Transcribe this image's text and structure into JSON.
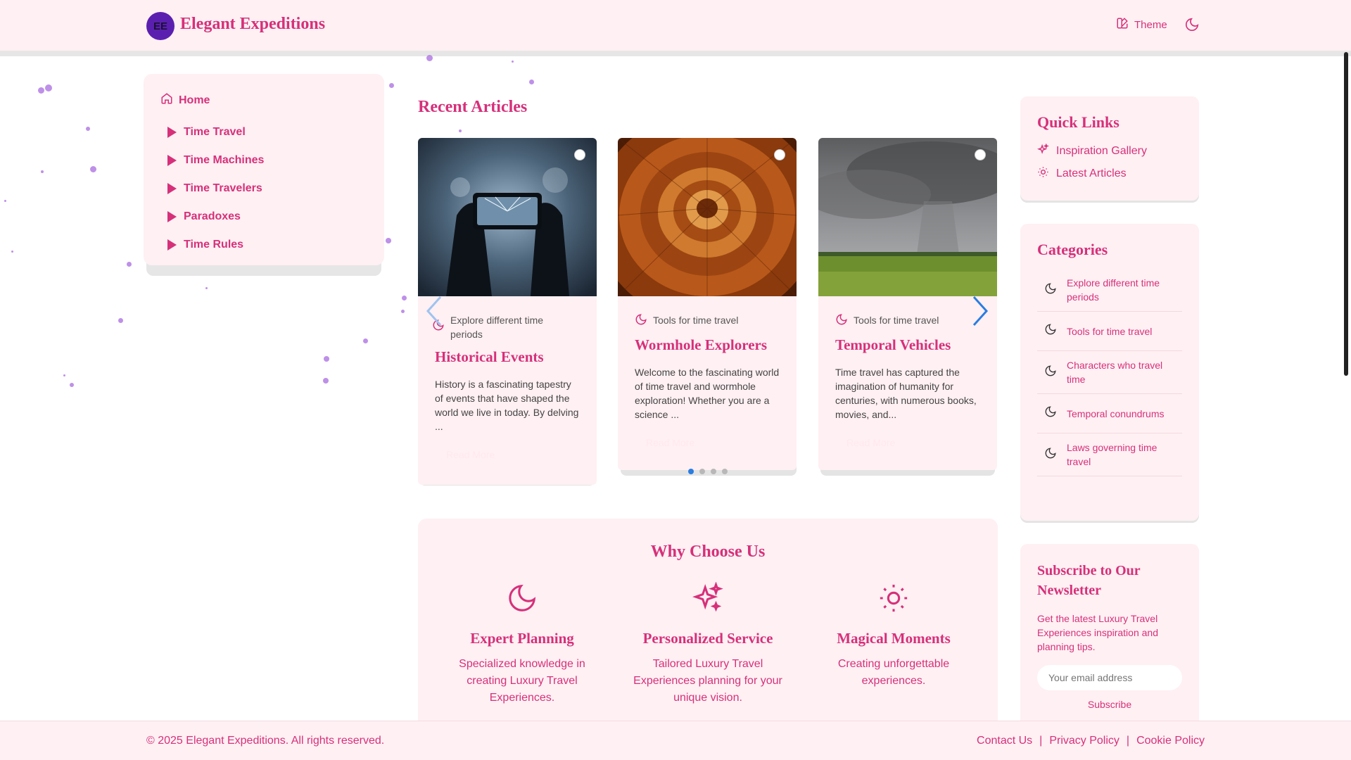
{
  "header": {
    "logo_initials": "EE",
    "title": "Elegant Expeditions",
    "theme_label": "Theme"
  },
  "sidebar": {
    "home": "Home",
    "items": [
      {
        "label": "Time Travel"
      },
      {
        "label": "Time Machines"
      },
      {
        "label": "Time Travelers"
      },
      {
        "label": "Paradoxes"
      },
      {
        "label": "Time Rules"
      }
    ]
  },
  "main": {
    "recent_title": "Recent Articles",
    "cards": [
      {
        "category": "Explore different time periods",
        "title": "Historical Events",
        "text": "History is a fascinating tapestry of events that have shaped the world we live in today. By delving ...",
        "read_more": "Read More",
        "image": "phone-photo-image"
      },
      {
        "category": "Tools for time travel",
        "title": "Wormhole Explorers",
        "text": "Welcome to the fascinating world of time travel and wormhole exploration! Whether you are a science ...",
        "read_more": "Read More",
        "image": "wormhole-tunnel-image"
      },
      {
        "category": "Tools for time travel",
        "title": "Temporal Vehicles",
        "text": "Time travel has captured the imagination of humanity for centuries, with numerous books, movies, and...",
        "read_more": "Read More",
        "image": "storm-field-image"
      }
    ],
    "carousel_pages": 4,
    "carousel_active": 0,
    "why": {
      "title": "Why Choose Us",
      "features": [
        {
          "icon": "moon-icon",
          "title": "Expert Planning",
          "text": "Specialized knowledge in creating Luxury Travel Experiences."
        },
        {
          "icon": "sparkles-icon",
          "title": "Personalized Service",
          "text": "Tailored Luxury Travel Experiences planning for your unique vision."
        },
        {
          "icon": "sun-icon",
          "title": "Magical Moments",
          "text": "Creating unforgettable experiences."
        }
      ]
    }
  },
  "quick_links": {
    "title": "Quick Links",
    "items": [
      {
        "label": "Inspiration Gallery",
        "icon": "sparkles-icon"
      },
      {
        "label": "Latest Articles",
        "icon": "sun-icon"
      }
    ]
  },
  "categories": {
    "title": "Categories",
    "items": [
      {
        "label": "Explore different time periods"
      },
      {
        "label": "Tools for time travel"
      },
      {
        "label": "Characters who travel time"
      },
      {
        "label": "Temporal conundrums"
      },
      {
        "label": "Laws governing time travel"
      }
    ]
  },
  "newsletter": {
    "title": "Subscribe to Our Newsletter",
    "text": "Get the latest Luxury Travel Experiences inspiration and planning tips.",
    "placeholder": "Your email address",
    "button": "Subscribe"
  },
  "footer": {
    "copyright": "© 2025 Elegant Expeditions. All rights reserved.",
    "links": [
      "Contact Us",
      "Privacy Policy",
      "Cookie Policy"
    ],
    "separator": "|"
  },
  "colors": {
    "accent": "#d6307a",
    "panel_bg": "#fff0f3",
    "logo_bg": "#5b1fb0",
    "carousel_active": "#2a7de1"
  }
}
